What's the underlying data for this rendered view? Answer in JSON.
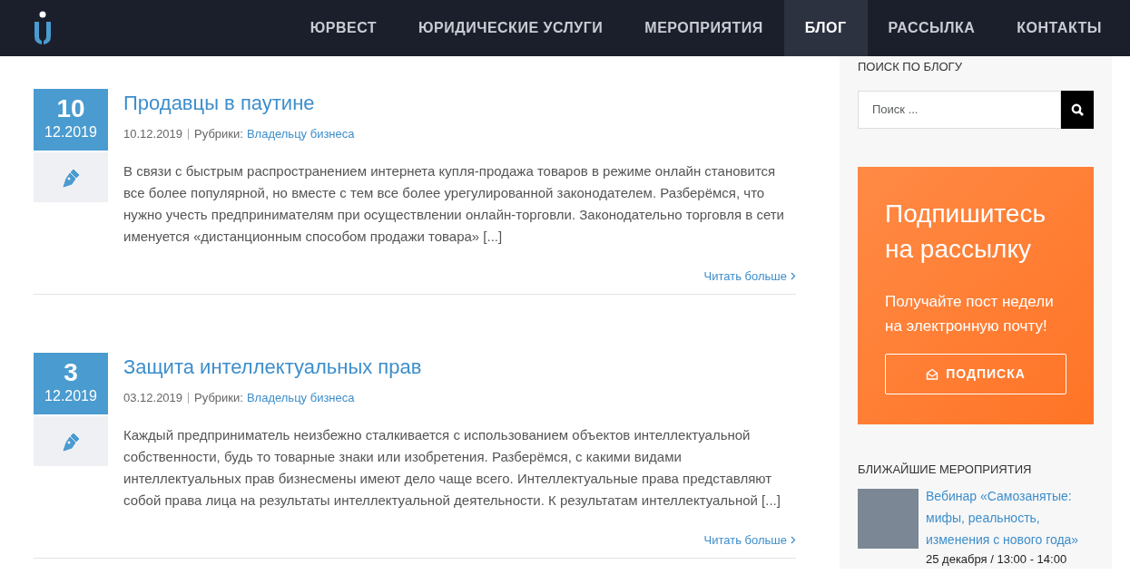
{
  "nav": [
    {
      "label": "ЮРВЕСТ",
      "selected": false
    },
    {
      "label": "ЮРИДИЧЕСКИЕ УСЛУГИ",
      "selected": false
    },
    {
      "label": "МЕРОПРИЯТИЯ",
      "selected": false
    },
    {
      "label": "БЛОГ",
      "selected": true
    },
    {
      "label": "РАССЫЛКА",
      "selected": false
    },
    {
      "label": "КОНТАКТЫ",
      "selected": false
    }
  ],
  "posts": [
    {
      "day": "10",
      "month": "12.2019",
      "title": "Продавцы в паутине",
      "date": "10.12.2019",
      "category_label": "Рубрики:",
      "category": "Владельцу бизнеса",
      "excerpt": "В связи с быстрым распространением интернета купля-продажа товаров в режиме онлайн становится все более популярной, но вместе с тем все более урегулированной законодателем. Разберёмся, что нужно учесть предпринимателям при осуществлении онлайн-торговли. Законодательно торговля в сети именуется «дистанционным способом продажи товара» [...]",
      "read_more": "Читать больше"
    },
    {
      "day": "3",
      "month": "12.2019",
      "title": "Защита интеллектуальных прав",
      "date": "03.12.2019",
      "category_label": "Рубрики:",
      "category": "Владельцу бизнеса",
      "excerpt": "Каждый предприниматель неизбежно сталкивается с использованием объектов интеллектуальной собственности, будь то товарные знаки или изобретения. Разберёмся, с какими видами интеллектуальных прав бизнесмены имеют дело чаще всего. Интеллектуальные права представляют собой права лица на результаты интеллектуальной деятельности. К результатам интеллектуальной [...]",
      "read_more": "Читать больше"
    }
  ],
  "sidebar": {
    "search_title": "ПОИСК ПО БЛОГУ",
    "search": {
      "placeholder": "Поиск ..."
    },
    "subscribe": {
      "title_lines": [
        "Подпишитесь",
        "на рассылку"
      ],
      "text_lines": [
        "Получайте пост недели",
        "на электронную почту!"
      ],
      "button": "ПОДПИСКА"
    },
    "events_title": "БЛИЖАЙШИЕ МЕРОПРИЯТИЯ",
    "events": [
      {
        "title": "Вебинар «Самозанятые: мифы, реальность, изменения с нового года»",
        "time": "25 декабря / 13:00 - 14:00"
      }
    ]
  }
}
